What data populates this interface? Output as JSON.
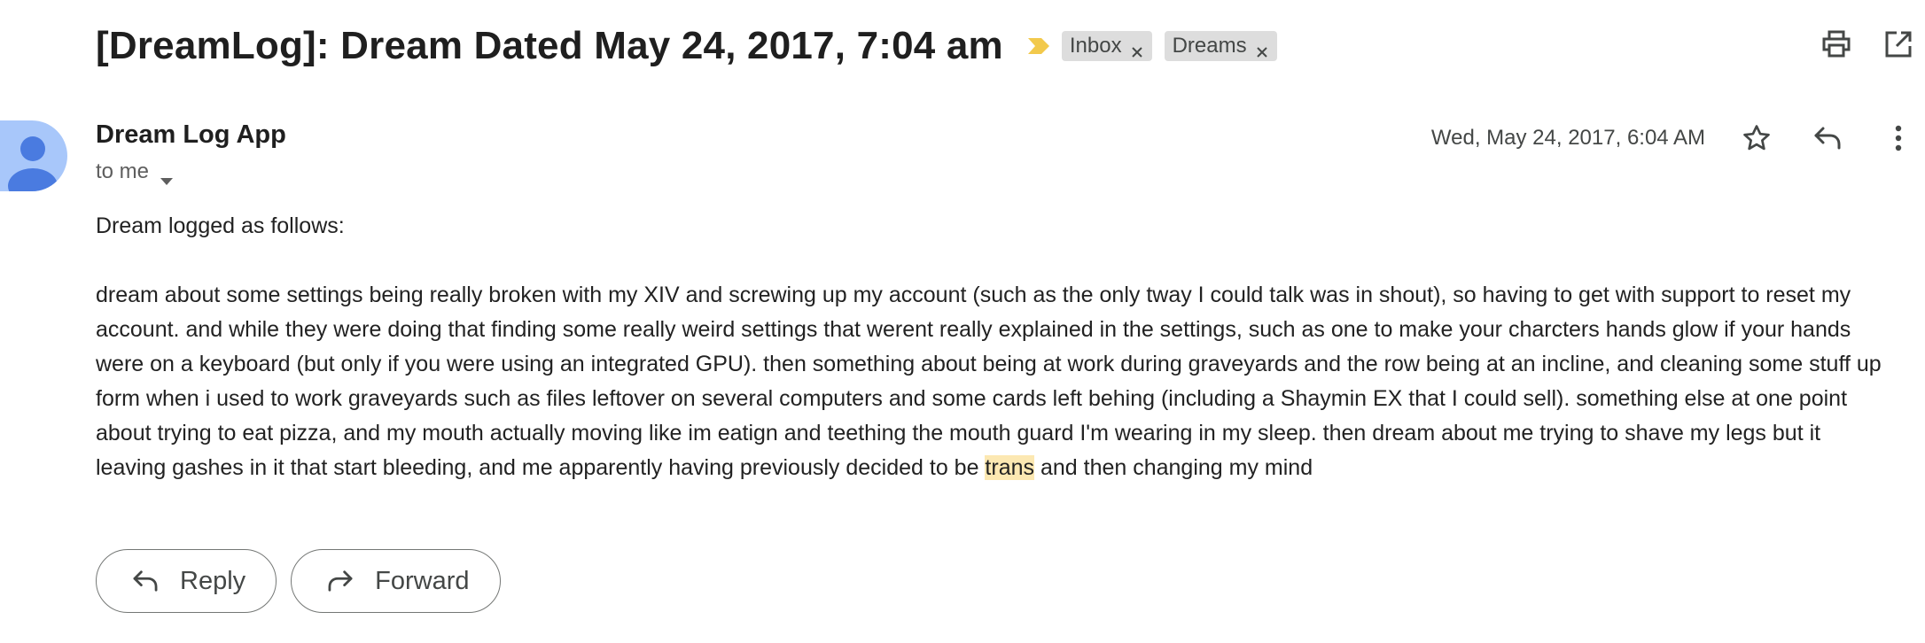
{
  "email": {
    "subject": "[DreamLog]: Dream Dated May 24, 2017, 7:04 am",
    "labels": [
      {
        "name": "Inbox"
      },
      {
        "name": "Dreams"
      }
    ],
    "sender_name": "Dream Log App",
    "recipient": "to me",
    "date": "Wed, May 24, 2017, 6:04 AM",
    "body_intro": "Dream logged as follows:",
    "body_main_before": "dream about some settings being really broken with my XIV and screwing up my account (such as the only tway I could talk was in shout), so having to get with support to reset my account. and while they were doing that finding some really weird settings that werent really explained in the settings, such as one to make your charcters hands glow if your hands were on a keyboard (but only if you were using an integrated GPU). then something about being at work during graveyards and the row being at an incline, and cleaning some stuff up form when i used to work graveyards such as files leftover on several computers and some cards left behing (including a Shaymin EX that I could sell). something else at one point about trying to eat pizza, and my mouth actually moving like im eatign and teething the mouth guard I'm wearing in my sleep. then dream about me trying to shave my legs but it leaving gashes in it that start bleeding, and me apparently having previously decided to be ",
    "body_highlight": "trans",
    "body_main_after": " and then changing my mind"
  },
  "actions": {
    "reply_label": "Reply",
    "forward_label": "Forward"
  },
  "icons": {
    "importance": "importance-marker-icon",
    "print": "print-icon",
    "open_new_window": "open-in-new-window-icon",
    "star": "star-icon",
    "reply": "reply-icon",
    "more": "more-vertical-icon"
  },
  "colors": {
    "importance_marker": "#f2c94c",
    "label_chip_bg": "#dddddd",
    "avatar_bg": "#a8c7fa",
    "avatar_fg": "#4a7be0",
    "highlight": "#fce8b2"
  }
}
